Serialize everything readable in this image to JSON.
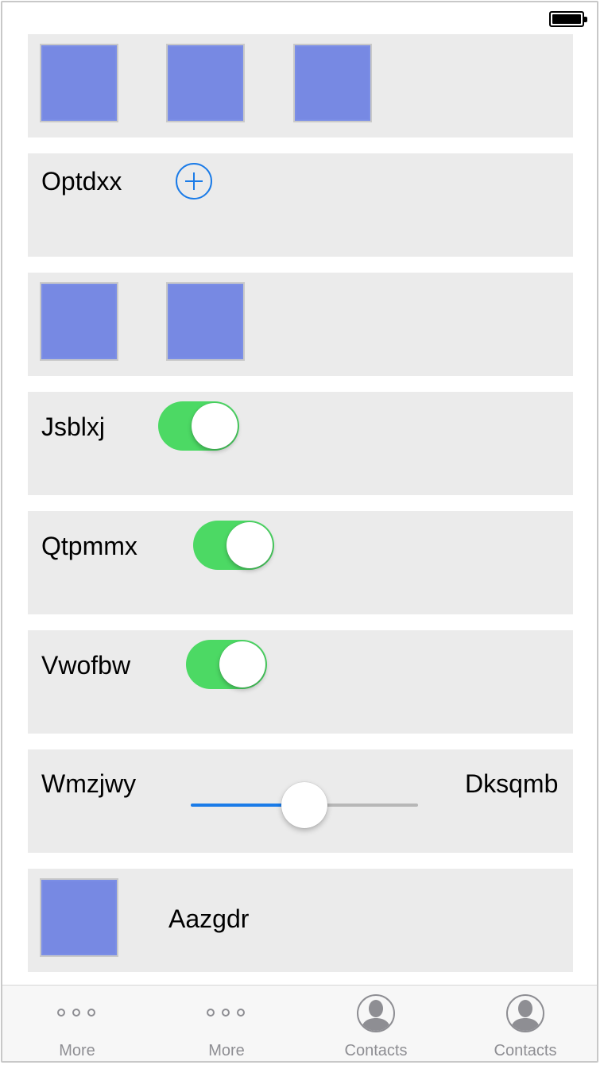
{
  "rows": {
    "add": {
      "label": "Optdxx"
    },
    "toggle1": {
      "label": "Jsblxj",
      "on": true
    },
    "toggle2": {
      "label": "Qtpmmx",
      "on": true
    },
    "toggle3": {
      "label": "Vwofbw",
      "on": true
    },
    "slider": {
      "left_label": "Wmzjwy",
      "right_label": "Dksqmb",
      "value": 0.5
    },
    "image_row": {
      "label": "Aazgdr"
    }
  },
  "tabs": [
    {
      "label": "More",
      "icon": "more-icon"
    },
    {
      "label": "More",
      "icon": "more-icon"
    },
    {
      "label": "Contacts",
      "icon": "contacts-icon"
    },
    {
      "label": "Contacts",
      "icon": "contacts-icon"
    }
  ],
  "colors": {
    "accent": "#1a7be8",
    "toggle_on": "#4cd964",
    "card_bg": "#ebebeb",
    "thumbnail": "#7789e3",
    "tab_inactive": "#8e8e93"
  }
}
